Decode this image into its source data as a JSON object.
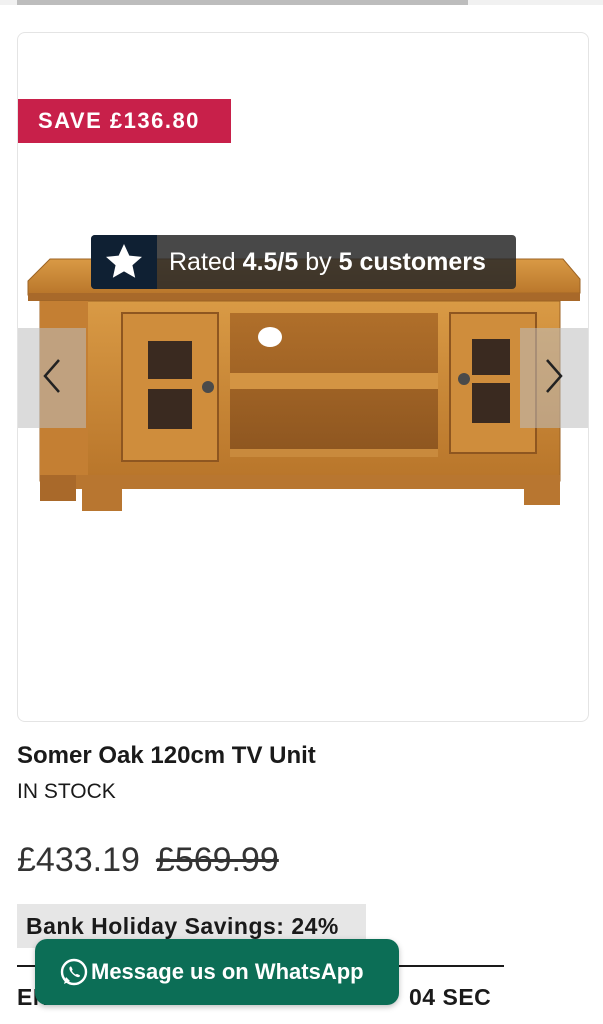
{
  "top_progress": {
    "fraction": 0.77
  },
  "product": {
    "save_badge": "SAVE £136.80",
    "rating": {
      "prefix": "Rated",
      "score": "4.5/5",
      "by": "by",
      "count": "5 customers"
    },
    "title": "Somer Oak 120cm TV Unit",
    "stock": "IN STOCK",
    "price_current": "£433.19",
    "price_was": "£569.99",
    "savings_label": "Bank Holiday Savings: 24%",
    "countdown_left": "EN",
    "countdown_right": "04 SEC"
  },
  "whatsapp": {
    "label": "Message us on WhatsApp"
  },
  "icons": {
    "rating": "star-icon",
    "prev": "chevron-left-icon",
    "next": "chevron-right-icon",
    "chat": "whatsapp-icon"
  },
  "colors": {
    "save_badge": "#c8204a",
    "rating_star_box": "#0f2033",
    "whatsapp_button": "#0c6e56",
    "savings_bg": "#e6e6e6"
  }
}
